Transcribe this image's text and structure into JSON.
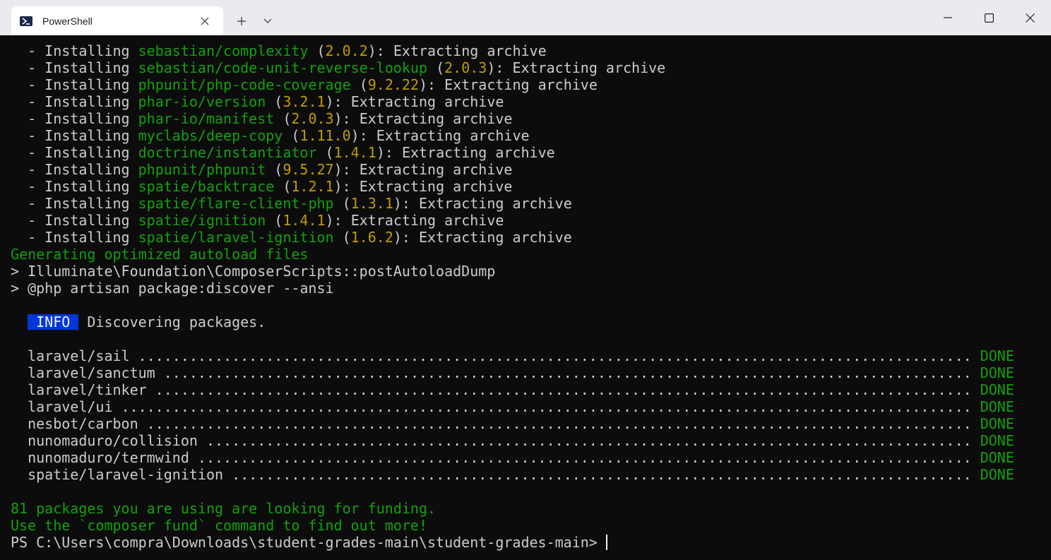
{
  "window": {
    "tab_title": "PowerShell",
    "controls": {
      "minimize": "minimize",
      "maximize": "maximize",
      "close": "close"
    }
  },
  "terminal": {
    "installs": [
      {
        "pkg": "sebastian/complexity",
        "ver": "2.0.2",
        "action": "Extracting archive"
      },
      {
        "pkg": "sebastian/code-unit-reverse-lookup",
        "ver": "2.0.3",
        "action": "Extracting archive"
      },
      {
        "pkg": "phpunit/php-code-coverage",
        "ver": "9.2.22",
        "action": "Extracting archive"
      },
      {
        "pkg": "phar-io/version",
        "ver": "3.2.1",
        "action": "Extracting archive"
      },
      {
        "pkg": "phar-io/manifest",
        "ver": "2.0.3",
        "action": "Extracting archive"
      },
      {
        "pkg": "myclabs/deep-copy",
        "ver": "1.11.0",
        "action": "Extracting archive"
      },
      {
        "pkg": "doctrine/instantiator",
        "ver": "1.4.1",
        "action": "Extracting archive"
      },
      {
        "pkg": "phpunit/phpunit",
        "ver": "9.5.27",
        "action": "Extracting archive"
      },
      {
        "pkg": "spatie/backtrace",
        "ver": "1.2.1",
        "action": "Extracting archive"
      },
      {
        "pkg": "spatie/flare-client-php",
        "ver": "1.3.1",
        "action": "Extracting archive"
      },
      {
        "pkg": "spatie/ignition",
        "ver": "1.4.1",
        "action": "Extracting archive"
      },
      {
        "pkg": "spatie/laravel-ignition",
        "ver": "1.6.2",
        "action": "Extracting archive"
      }
    ],
    "install_prefix": "  - Installing ",
    "generating": "Generating optimized autoload files",
    "script1": "> Illuminate\\Foundation\\ComposerScripts::postAutoloadDump",
    "script2": "> @php artisan package:discover --ansi",
    "info_badge": " INFO ",
    "info_text": " Discovering packages.",
    "discovered": [
      {
        "name": "laravel/sail",
        "status": "DONE"
      },
      {
        "name": "laravel/sanctum",
        "status": "DONE"
      },
      {
        "name": "laravel/tinker",
        "status": "DONE"
      },
      {
        "name": "laravel/ui",
        "status": "DONE"
      },
      {
        "name": "nesbot/carbon",
        "status": "DONE"
      },
      {
        "name": "nunomaduro/collision",
        "status": "DONE"
      },
      {
        "name": "nunomaduro/termwind",
        "status": "DONE"
      },
      {
        "name": "spatie/laravel-ignition",
        "status": "DONE"
      }
    ],
    "funding1": "81 packages you are using are looking for funding.",
    "funding2": "Use the `composer fund` command to find out more!",
    "prompt": "PS C:\\Users\\compra\\Downloads\\student-grades-main\\student-grades-main> "
  },
  "colors": {
    "background": "#0c0c0c",
    "green": "#13a10e",
    "yellow": "#c19c00",
    "text": "#cccccc",
    "info_bg": "#0037da"
  }
}
